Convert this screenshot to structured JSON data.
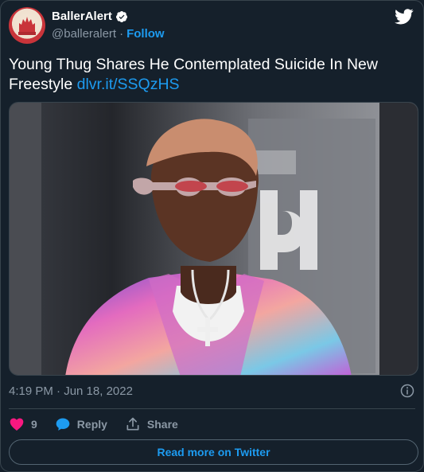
{
  "account": {
    "display_name": "BallerAlert",
    "handle": "@balleralert",
    "separator": "·",
    "follow_label": "Follow",
    "verified": true
  },
  "tweet": {
    "text": "Young Thug Shares He Contemplated Suicide In New Freestyle ",
    "link_text": "dlvr.it/SSQzHS",
    "time": "4:19 PM",
    "date": "Jun 18, 2022",
    "time_date": "4:19 PM · Jun 18, 2022"
  },
  "actions": {
    "like_count": "9",
    "reply_label": "Reply",
    "share_label": "Share"
  },
  "read_more_label": "Read more on Twitter",
  "icons": {
    "logo": "twitter-bird-icon",
    "verified": "verified-badge-icon",
    "info": "info-icon",
    "like": "heart-icon",
    "reply": "reply-bubble-icon",
    "share": "share-upload-icon"
  },
  "colors": {
    "background": "#15202b",
    "border": "#38444d",
    "accent": "#1d9bf0",
    "muted_text": "#8b98a5",
    "like": "#f91880"
  }
}
